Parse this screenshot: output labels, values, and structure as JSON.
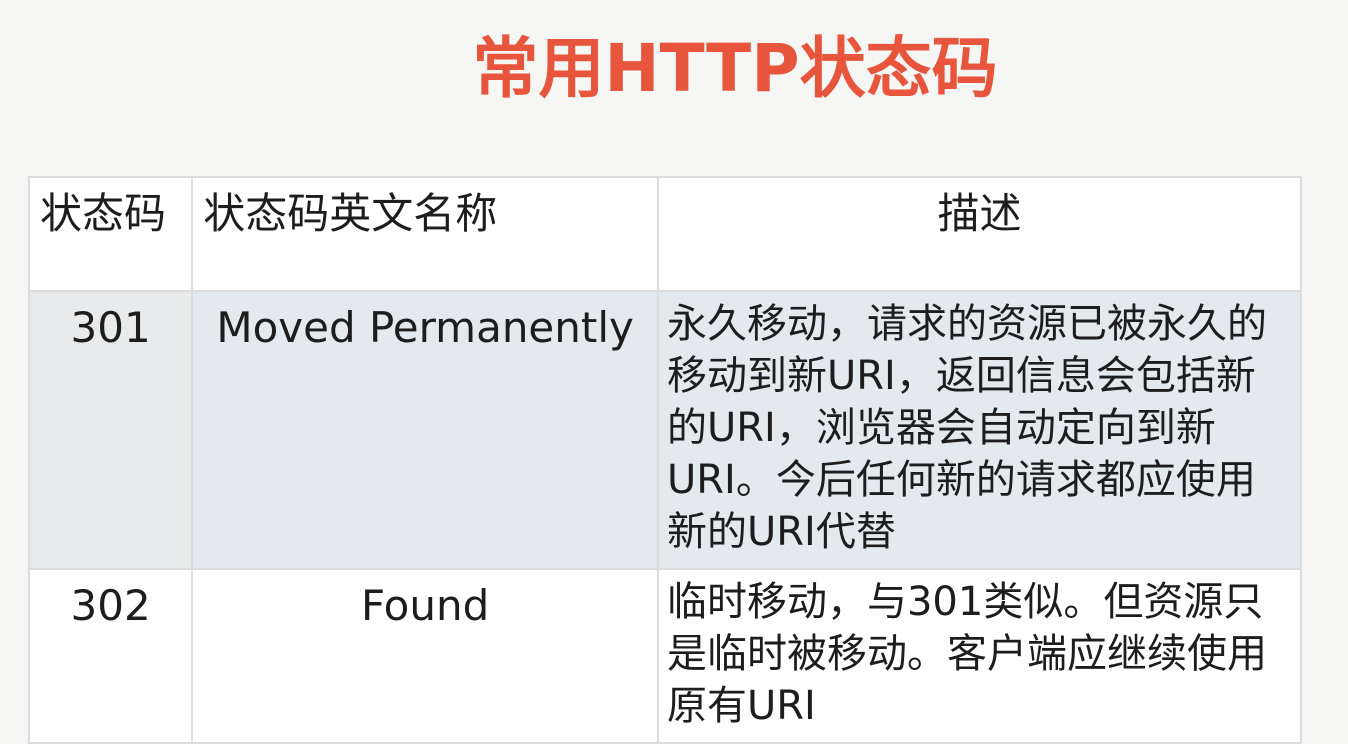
{
  "title": "常用HTTP状态码",
  "table": {
    "headers": {
      "code": "状态码",
      "name": "状态码英文名称",
      "desc": "描述"
    },
    "rows": [
      {
        "code": "301",
        "name": "Moved Permanently",
        "desc": "永久移动，请求的资源已被永久的移动到新URI，返回信息会包括新的URI，浏览器会自动定向到新URI。今后任何新的请求都应使用新的URI代替"
      },
      {
        "code": "302",
        "name": "Found",
        "desc": "临时移动，与301类似。但资源只是临时被移动。客户端应继续使用原有URI"
      }
    ]
  }
}
